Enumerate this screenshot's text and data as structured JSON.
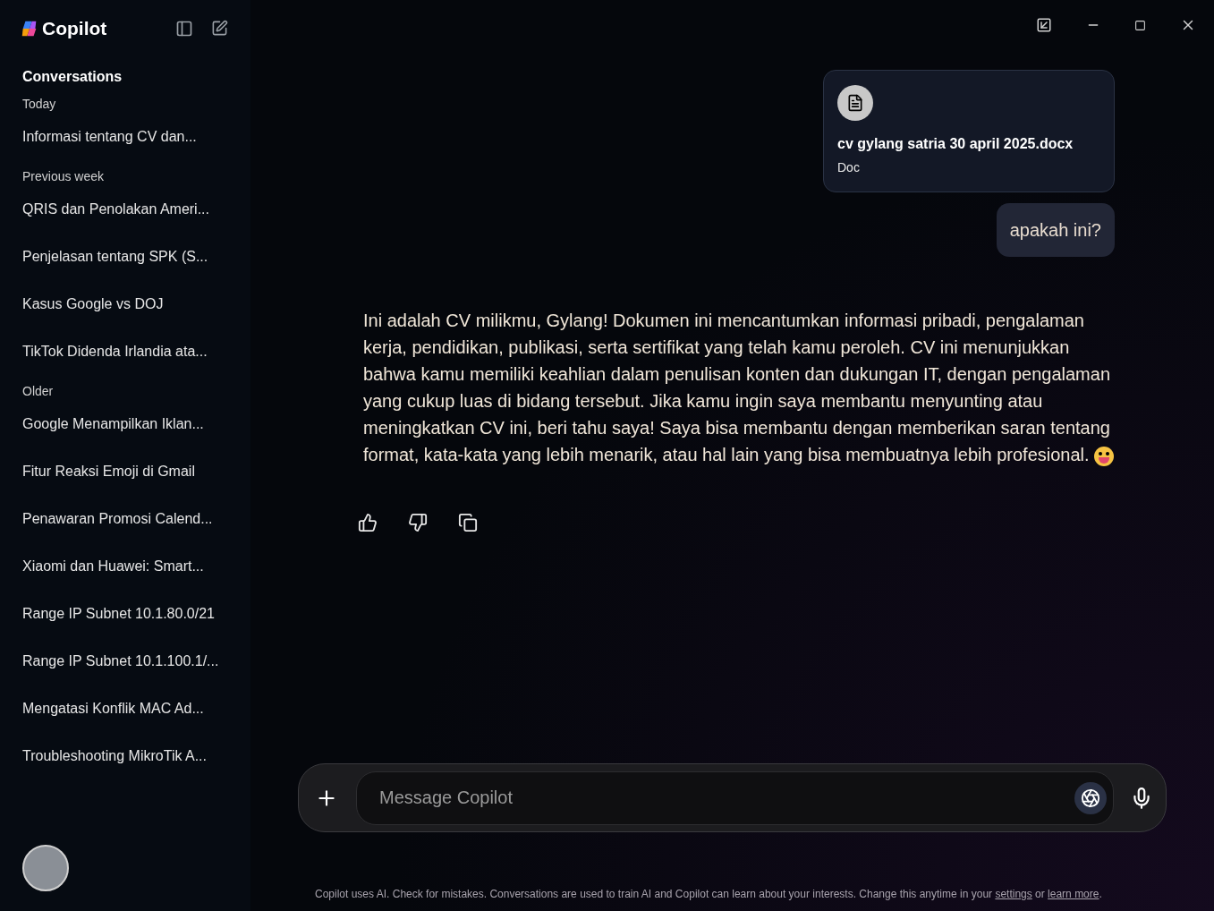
{
  "app": {
    "name": "Copilot"
  },
  "sidebar": {
    "heading": "Conversations",
    "groups": [
      {
        "label": "Today",
        "items": [
          {
            "title": "Informasi tentang CV dan...",
            "selected": false
          }
        ]
      },
      {
        "label": "Previous week",
        "items": [
          {
            "title": "QRIS dan Penolakan Ameri...",
            "selected": false
          },
          {
            "title": "Penjelasan tentang SPK (S...",
            "selected": false
          },
          {
            "title": "Kasus Google vs DOJ",
            "selected": false
          },
          {
            "title": "TikTok Didenda Irlandia ata...",
            "selected": false
          }
        ]
      },
      {
        "label": "Older",
        "items": [
          {
            "title": "Google Menampilkan Iklan...",
            "selected": false
          },
          {
            "title": "Fitur Reaksi Emoji di Gmail",
            "selected": false
          },
          {
            "title": "Penawaran Promosi Calend...",
            "selected": false
          },
          {
            "title": "Xiaomi dan Huawei: Smart...",
            "selected": false
          },
          {
            "title": "Range IP Subnet 10.1.80.0/21",
            "selected": false
          },
          {
            "title": "Range IP Subnet 10.1.100.1/...",
            "selected": false
          },
          {
            "title": "Mengatasi Konflik MAC Ad...",
            "selected": false
          },
          {
            "title": "Troubleshooting MikroTik A...",
            "selected": false
          }
        ]
      }
    ]
  },
  "messages": [
    {
      "kind": "file",
      "name": "cv gylang satria 30 april 2025.docx",
      "type": "Doc"
    },
    {
      "kind": "user",
      "text": "apakah ini?"
    },
    {
      "kind": "assistant",
      "text": "Ini adalah CV milikmu, Gylang! Dokumen ini mencantumkan informasi pribadi, pengalaman kerja, pendidikan, publikasi, serta sertifikat yang telah kamu peroleh. CV ini menunjukkan bahwa kamu memiliki keahlian dalam penulisan konten dan dukungan IT, dengan pengalaman yang cukup luas di bidang tersebut. Jika kamu ingin saya membantu menyunting atau meningkatkan CV ini, beri tahu saya! Saya bisa membantu dengan memberikan saran tentang format, kata-kata yang lebih menarik, atau hal lain yang bisa membuatnya lebih profesional."
    }
  ],
  "composer": {
    "placeholder": "Message Copilot"
  },
  "disclaimer": {
    "text": "Copilot uses AI. Check for mistakes. Conversations are used to train AI and Copilot can learn about your interests. Change this anytime in your ",
    "link_1": "settings",
    "middle": " or ",
    "link_2": "learn more",
    "end": "."
  }
}
